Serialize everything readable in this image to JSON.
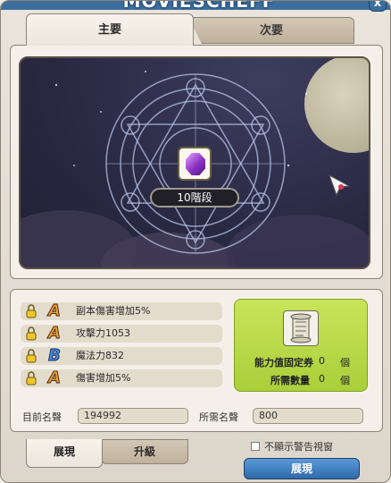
{
  "window": {
    "title": "MOVIESCHEFF",
    "close_glyph": "x"
  },
  "top_tabs": [
    {
      "label": "主要",
      "active": true
    },
    {
      "label": "次要",
      "active": false
    }
  ],
  "scene": {
    "level_label": "10階段"
  },
  "stats": [
    {
      "grade": "A",
      "text": "副本傷害增加5%"
    },
    {
      "grade": "A",
      "text": "攻擊力1053"
    },
    {
      "grade": "B",
      "text": "魔法力832"
    },
    {
      "grade": "A",
      "text": "傷害增加5%"
    }
  ],
  "cost_panel": {
    "ticket_label": "能力值固定券",
    "ticket_value": "0",
    "ticket_unit": "個",
    "required_label": "所需數量",
    "required_value": "0",
    "required_unit": "個"
  },
  "fame": {
    "current_label": "目前名聲",
    "current_value": "194992",
    "required_label": "所需名聲",
    "required_value": "800"
  },
  "bottom_tabs": [
    {
      "label": "展現",
      "active": true
    },
    {
      "label": "升級",
      "active": false
    }
  ],
  "warning_checkbox": {
    "label": "不顯示警告視窗",
    "checked": false
  },
  "action_button": {
    "label": "展現"
  },
  "colors": {
    "accent": "#3c6f9f",
    "green_panel": "#b8d94a",
    "grade_a": "#f0a030",
    "grade_b": "#4e8fe6"
  }
}
